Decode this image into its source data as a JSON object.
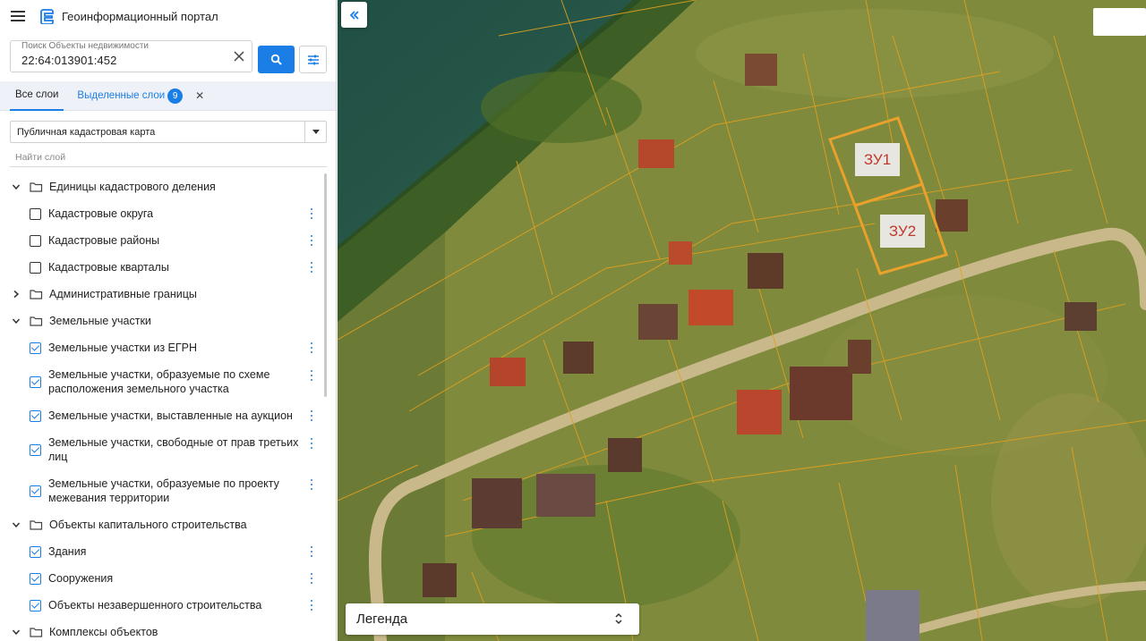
{
  "app": {
    "title": "Геоинформационный портал"
  },
  "search": {
    "label": "Поиск Объекты недвижимости",
    "value": "22:64:013901:452"
  },
  "tabs": {
    "all_layers": "Все слои",
    "selected_layers": "Выделенные слои",
    "selected_count": "9"
  },
  "basemap_select": {
    "value": "Публичная кадастровая карта"
  },
  "find_layer": {
    "placeholder": "Найти слой"
  },
  "tree": {
    "groups": [
      {
        "label": "Единицы кадастрового деления",
        "expanded": true,
        "items": [
          {
            "label": "Кадастровые округа",
            "checked": false
          },
          {
            "label": "Кадастровые районы",
            "checked": false
          },
          {
            "label": "Кадастровые кварталы",
            "checked": false
          }
        ]
      },
      {
        "label": "Административные границы",
        "expanded": false,
        "items": []
      },
      {
        "label": "Земельные участки",
        "expanded": true,
        "items": [
          {
            "label": "Земельные участки из ЕГРН",
            "checked": true
          },
          {
            "label": "Земельные участки, образуемые по схеме расположения земельного участка",
            "checked": true
          },
          {
            "label": "Земельные участки, выставленные на аукцион",
            "checked": true
          },
          {
            "label": "Земельные участки, свободные от прав третьих лиц",
            "checked": true
          },
          {
            "label": "Земельные участки, образуемые по проекту межевания территории",
            "checked": true
          }
        ]
      },
      {
        "label": "Объекты капитального строительства",
        "expanded": true,
        "items": [
          {
            "label": "Здания",
            "checked": true
          },
          {
            "label": "Сооружения",
            "checked": true
          },
          {
            "label": "Объекты незавершенного строительства",
            "checked": true
          }
        ]
      },
      {
        "label": "Комплексы объектов",
        "expanded": true,
        "items": []
      }
    ]
  },
  "map": {
    "labels": {
      "zu1": "ЗУ1",
      "zu2": "ЗУ2"
    },
    "legend": "Легенда",
    "colors": {
      "parcel_line": "#e0a020",
      "highlight": "#e8a22c",
      "accent": "#1b7ee6"
    }
  }
}
